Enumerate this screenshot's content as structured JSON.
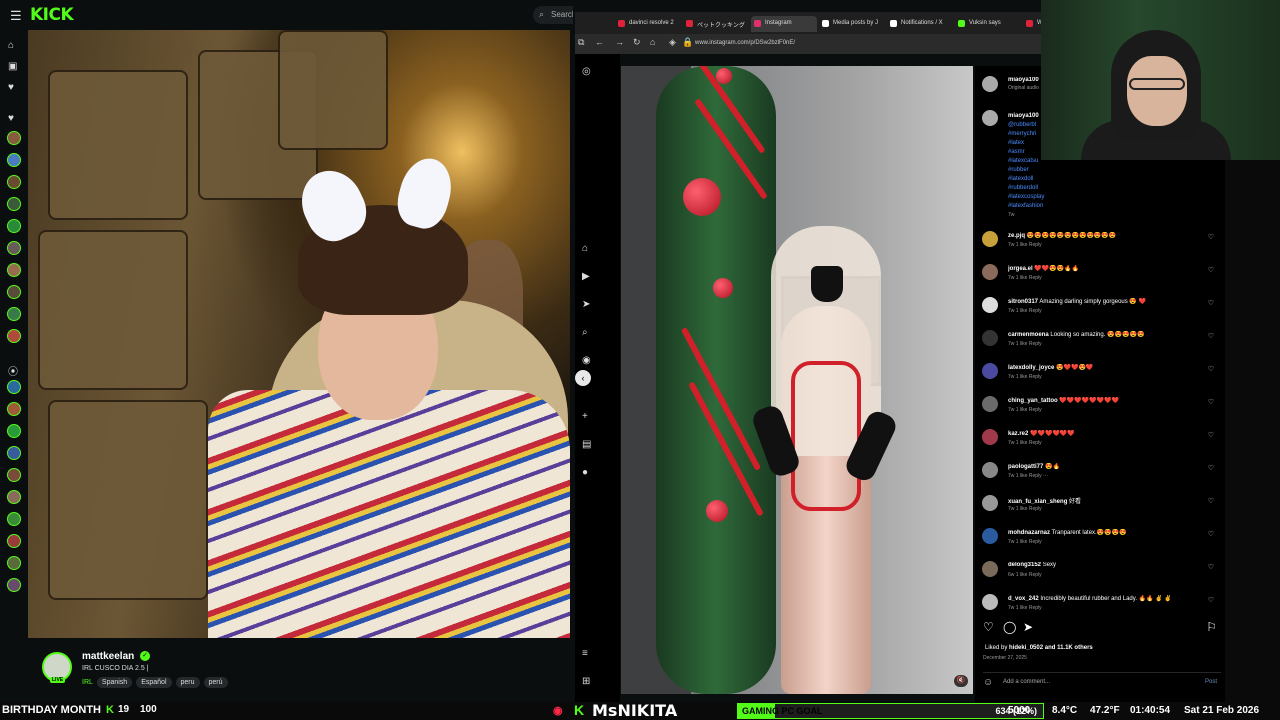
{
  "kick": {
    "logo": "KICK",
    "search_placeholder": "Search",
    "streamer": {
      "name": "mattkeelan",
      "title": "IRL CUSCO DIA 2.5 |",
      "category": "IRL",
      "tags": [
        "Spanish",
        "Español",
        "peru",
        "perú"
      ],
      "live_label": "LIVE"
    }
  },
  "browser": {
    "tabs": [
      {
        "label": "davinci resolve 2",
        "color": "#e0223a"
      },
      {
        "label": "ペットクッキング",
        "color": "#e0223a"
      },
      {
        "label": "Instagram",
        "color": "#e1306c",
        "active": true
      },
      {
        "label": "Media posts by J",
        "color": "#ffffff"
      },
      {
        "label": "Notifications / X",
        "color": "#ffffff"
      },
      {
        "label": "Vuksin says",
        "color": "#53fc18"
      },
      {
        "label": "W",
        "color": "#e0223a"
      }
    ],
    "url": "www.instagram.com/p/DSw2bzlF0nE/"
  },
  "instagram": {
    "op": [
      {
        "user": "miaoya100",
        "sub": "Original audio"
      },
      {
        "user": "miaoya100",
        "hashtags": [
          "@rubberbl",
          "#merrychri",
          "#latex",
          "#asmr",
          "#latexcatsu",
          "#rubber",
          "#latexdoll",
          "#rubberdoll",
          "#latexcosplay",
          "#latexfashion"
        ],
        "age": "7w"
      }
    ],
    "comments": [
      {
        "user": "ze.pjq",
        "text": "😍😍😍😍😍😍😍😍😍😍😍😍",
        "meta": "7w   1 like   Reply"
      },
      {
        "user": "jorgea.el",
        "text": "❤️❤️😍😍🔥🔥",
        "meta": "7w   1 like   Reply"
      },
      {
        "user": "sitron0317",
        "text": "Amazing darling simply gorgeous 😍 ❤️",
        "meta": "7w   1 like   Reply"
      },
      {
        "user": "carmenmoena",
        "text": "Looking so amazing. 😍😍😍😍😍",
        "meta": "7w   1 like   Reply"
      },
      {
        "user": "latexdolly_joyce",
        "text": "😍❤️❤️😍❤️",
        "meta": "7w   1 like   Reply"
      },
      {
        "user": "ching_yan_tattoo",
        "text": "❤️❤️❤️❤️❤️❤️❤️❤️",
        "meta": "7w   1 like   Reply"
      },
      {
        "user": "kaz.re2",
        "text": "❤️❤️❤️❤️❤️❤️",
        "meta": "7w   1 like   Reply"
      },
      {
        "user": "paologatti77",
        "text": "😍🔥",
        "meta": "7w   1 like   Reply   ···"
      },
      {
        "user": "xuan_fu_xian_sheng",
        "text": "好看",
        "meta": "7w   1 like   Reply"
      },
      {
        "user": "mohdnazarnaz",
        "text": "Tranparent latex.😍😍😍😍",
        "meta": "7w   1 like   Reply"
      },
      {
        "user": "delong3152",
        "text": "Sexy",
        "meta": "6w   1 like   Reply"
      },
      {
        "user": "d_vox_242",
        "text": "Incredibly beautiful rubber and Lady. 🔥🔥 ✌️ ✌️",
        "meta": "7w   1 like   Reply"
      }
    ],
    "liked_by_user": "hideki_0502",
    "liked_by_rest": "and 11.1K others",
    "liked_by_prefix": "Liked by",
    "date": "December 27, 2025",
    "add_comment_placeholder": "Add a comment...",
    "post_label": "Post"
  },
  "ticker": {
    "left_text": "BIRTHDAY MONTH",
    "left_count": "19",
    "left_pct": "100",
    "brand": "MsNIKITA",
    "goal_label": "GAMING PC GOAL",
    "goal_count": "634 (12%)",
    "goal_progress": 0.12,
    "amount": "5000",
    "temp": "8.4°C",
    "temp_f": "47.2°F",
    "time": "01:40:54",
    "date": "Sat 21 Feb 2026"
  }
}
